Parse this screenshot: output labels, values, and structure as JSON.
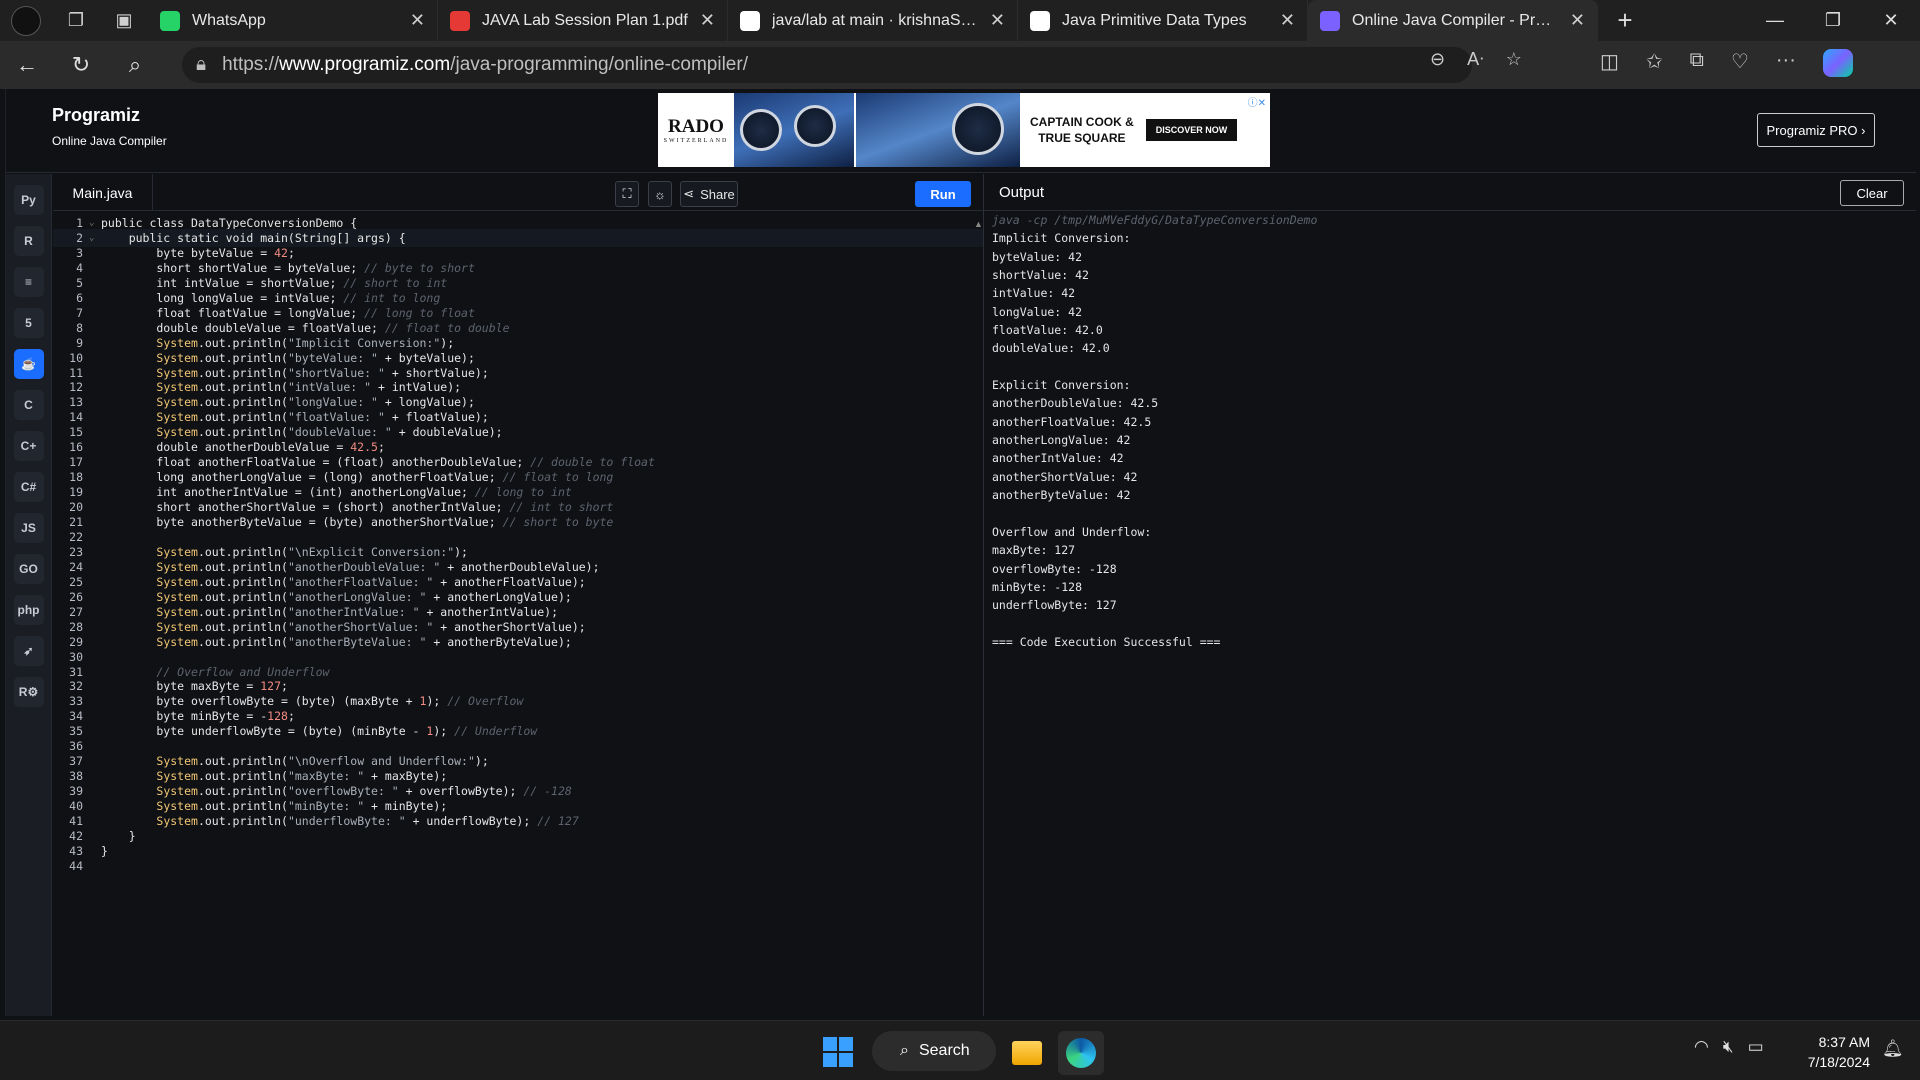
{
  "browser": {
    "tabs": [
      {
        "title": "WhatsApp",
        "icon": "whatsapp-icon",
        "color": "#25d366",
        "active": false
      },
      {
        "title": "JAVA Lab Session Plan 1.pdf",
        "icon": "pdf-icon",
        "color": "#e53935",
        "active": false
      },
      {
        "title": "java/lab at main · krishnaSubram",
        "icon": "github-icon",
        "color": "#ffffff",
        "active": false
      },
      {
        "title": "Java Primitive Data Types",
        "icon": "chatgpt-icon",
        "color": "#ffffff",
        "active": false
      },
      {
        "title": "Online Java Compiler - Programiz",
        "icon": "programiz-icon",
        "color": "#7b61ff",
        "active": true
      }
    ],
    "url_prefix": "https://",
    "url_host": "www.programiz.com",
    "url_path": "/java-programming/online-compiler/"
  },
  "site": {
    "brand": "Programiz",
    "subtitle": "Online Java Compiler",
    "pro_button": "Programiz PRO ›",
    "ad": {
      "brand": "RADO",
      "brand_sub": "SWITZERLAND",
      "caption_line1": "CAPTAIN COOK &",
      "caption_line2": "TRUE SQUARE",
      "cta": "DISCOVER NOW"
    }
  },
  "sidebar": {
    "items": [
      {
        "name": "python-icon",
        "glyph": "Py",
        "active": false
      },
      {
        "name": "r-icon",
        "glyph": "R",
        "active": false
      },
      {
        "name": "sql-icon",
        "glyph": "≡",
        "active": false
      },
      {
        "name": "html-icon",
        "glyph": "5",
        "active": false
      },
      {
        "name": "java-icon",
        "glyph": "☕",
        "active": true
      },
      {
        "name": "c-icon",
        "glyph": "C",
        "active": false
      },
      {
        "name": "cpp-icon",
        "glyph": "C+",
        "active": false
      },
      {
        "name": "csharp-icon",
        "glyph": "C#",
        "active": false
      },
      {
        "name": "javascript-icon",
        "glyph": "JS",
        "active": false
      },
      {
        "name": "go-icon",
        "glyph": "GO",
        "active": false
      },
      {
        "name": "php-icon",
        "glyph": "php",
        "active": false
      },
      {
        "name": "swift-icon",
        "glyph": "➶",
        "active": false
      },
      {
        "name": "rust-icon",
        "glyph": "R⚙",
        "active": false
      }
    ]
  },
  "editor": {
    "file_tab": "Main.java",
    "share_label": "Share",
    "run_label": "Run",
    "lines": [
      "public class DataTypeConversionDemo {",
      "    public static void main(String[] args) {",
      "        byte byteValue = 42;",
      "        short shortValue = byteValue; // byte to short",
      "        int intValue = shortValue; // short to int",
      "        long longValue = intValue; // int to long",
      "        float floatValue = longValue; // long to float",
      "        double doubleValue = floatValue; // float to double",
      "        System.out.println(\"Implicit Conversion:\");",
      "        System.out.println(\"byteValue: \" + byteValue);",
      "        System.out.println(\"shortValue: \" + shortValue);",
      "        System.out.println(\"intValue: \" + intValue);",
      "        System.out.println(\"longValue: \" + longValue);",
      "        System.out.println(\"floatValue: \" + floatValue);",
      "        System.out.println(\"doubleValue: \" + doubleValue);",
      "        double anotherDoubleValue = 42.5;",
      "        float anotherFloatValue = (float) anotherDoubleValue; // double to float",
      "        long anotherLongValue = (long) anotherFloatValue; // float to long",
      "        int anotherIntValue = (int) anotherLongValue; // long to int",
      "        short anotherShortValue = (short) anotherIntValue; // int to short",
      "        byte anotherByteValue = (byte) anotherShortValue; // short to byte",
      "",
      "        System.out.println(\"\\nExplicit Conversion:\");",
      "        System.out.println(\"anotherDoubleValue: \" + anotherDoubleValue);",
      "        System.out.println(\"anotherFloatValue: \" + anotherFloatValue);",
      "        System.out.println(\"anotherLongValue: \" + anotherLongValue);",
      "        System.out.println(\"anotherIntValue: \" + anotherIntValue);",
      "        System.out.println(\"anotherShortValue: \" + anotherShortValue);",
      "        System.out.println(\"anotherByteValue: \" + anotherByteValue);",
      "",
      "        // Overflow and Underflow",
      "        byte maxByte = 127;",
      "        byte overflowByte = (byte) (maxByte + 1); // Overflow",
      "        byte minByte = -128;",
      "        byte underflowByte = (byte) (minByte - 1); // Underflow",
      "",
      "        System.out.println(\"\\nOverflow and Underflow:\");",
      "        System.out.println(\"maxByte: \" + maxByte);",
      "        System.out.println(\"overflowByte: \" + overflowByte); // -128",
      "        System.out.println(\"minByte: \" + minByte);",
      "        System.out.println(\"underflowByte: \" + underflowByte); // 127",
      "    }",
      "}",
      ""
    ]
  },
  "output": {
    "title": "Output",
    "clear_label": "Clear",
    "command": "java -cp /tmp/MuMVeFddyG/DataTypeConversionDemo",
    "lines": [
      "Implicit Conversion:",
      "byteValue: 42",
      "shortValue: 42",
      "intValue: 42",
      "longValue: 42",
      "floatValue: 42.0",
      "doubleValue: 42.0",
      "",
      "Explicit Conversion:",
      "anotherDoubleValue: 42.5",
      "anotherFloatValue: 42.5",
      "anotherLongValue: 42",
      "anotherIntValue: 42",
      "anotherShortValue: 42",
      "anotherByteValue: 42",
      "",
      "Overflow and Underflow:",
      "maxByte: 127",
      "overflowByte: -128",
      "minByte: -128",
      "underflowByte: 127",
      "",
      "=== Code Execution Successful ==="
    ]
  },
  "taskbar": {
    "search_label": "Search",
    "time": "8:37 AM",
    "date": "7/18/2024"
  }
}
